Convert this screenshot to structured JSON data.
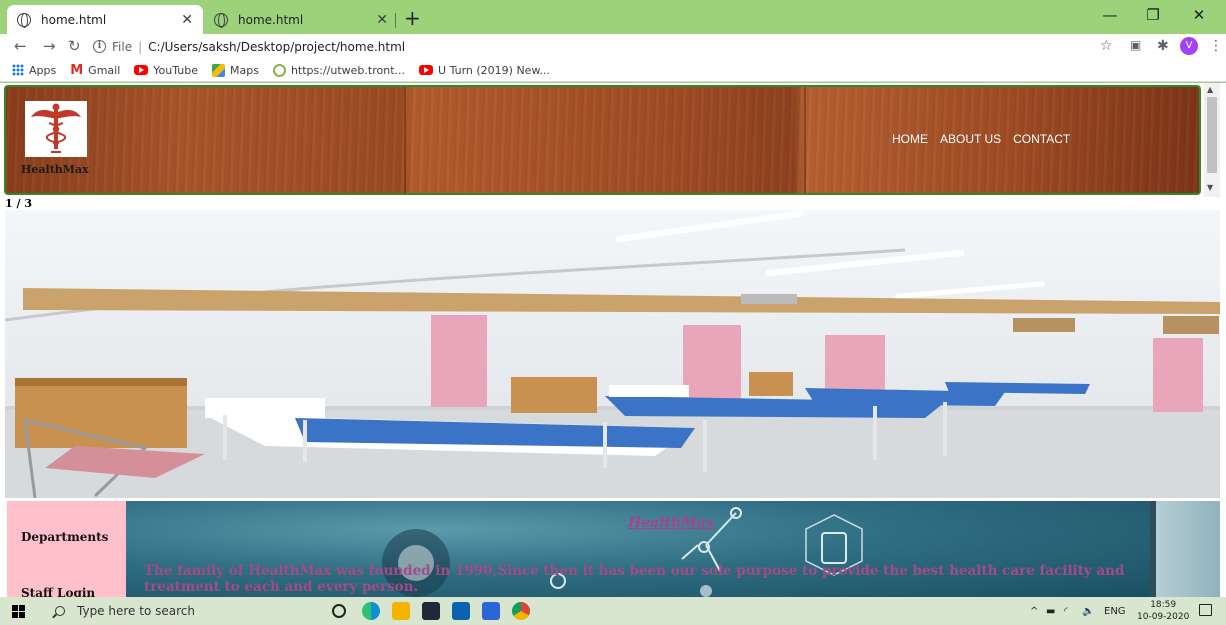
{
  "browser": {
    "tabs": [
      {
        "title": "home.html",
        "active": true
      },
      {
        "title": "home.html",
        "active": false
      }
    ],
    "address": {
      "scheme_label": "File",
      "url": "C:/Users/saksh/Desktop/project/home.html"
    },
    "profile_initial": "V",
    "bookmarks": [
      {
        "label": "Apps",
        "icon": "apps-grid-icon"
      },
      {
        "label": "Gmail",
        "icon": "gmail-icon"
      },
      {
        "label": "YouTube",
        "icon": "youtube-icon"
      },
      {
        "label": "Maps",
        "icon": "maps-icon"
      },
      {
        "label": "https://utweb.tront...",
        "icon": "utorrent-icon"
      },
      {
        "label": "U Turn (2019) New...",
        "icon": "youtube-icon"
      }
    ]
  },
  "page": {
    "brand": "HealthMax",
    "nav": [
      "HOME",
      "ABOUT US",
      "CONTACT"
    ],
    "slideshow": {
      "counter": "1 / 3"
    },
    "sidebar": [
      "Departments",
      "Staff Login"
    ],
    "about": {
      "title": "HealthMax",
      "text": "The family of HealthMax was founded in 1990,Since then it has been our sole purpose to provide the best health care facility and treatment to each and every person."
    }
  },
  "taskbar": {
    "search_placeholder": "Type here to search",
    "language": "ENG",
    "time": "18:59",
    "date": "10-09-2020"
  },
  "colors": {
    "desktop_green": "#9cd27a",
    "header_border": "#2f8a2a",
    "sidebar_pink": "#ffc0cb",
    "about_text": "#a44a86"
  }
}
